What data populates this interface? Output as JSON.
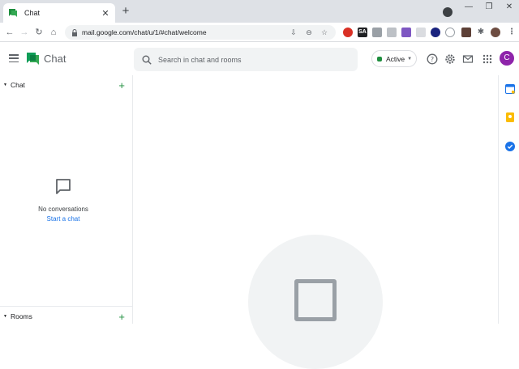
{
  "browser": {
    "tab_title": "Chat",
    "tab_close": "✕",
    "new_tab": "+",
    "url": "mail.google.com/chat/u/1/#chat/welcome",
    "win_min": "—",
    "win_max": "❐",
    "win_close": "✕",
    "ext_labels": [
      "",
      "SA",
      "",
      "",
      "",
      "",
      "",
      "",
      "",
      ""
    ]
  },
  "header": {
    "app_title": "Chat",
    "search_placeholder": "Search in chat and rooms",
    "status_label": "Active",
    "avatar_letter": "C"
  },
  "sidebar": {
    "chat_section_label": "Chat",
    "empty_text": "No conversations",
    "start_chat_link": "Start a chat",
    "rooms_section_label": "Rooms"
  },
  "colors": {
    "brand_green": "#1e8e3e",
    "link_blue": "#1a73e8",
    "avatar_purple": "#8e24aa"
  }
}
